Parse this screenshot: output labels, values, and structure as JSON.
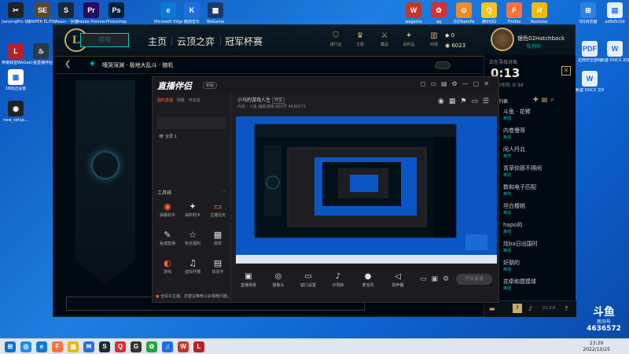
{
  "desktop": {
    "icons_top": [
      {
        "label": "JianyingPro 快捷方式",
        "color": "#222",
        "glyph": "✂"
      },
      {
        "label": "SNIPER ELITE V2",
        "color": "#5a4a2a",
        "glyph": "SE"
      },
      {
        "label": "steam - 快捷",
        "color": "#1b2838",
        "glyph": "S"
      },
      {
        "label": "Adobe Premiere",
        "color": "#2a0a5a",
        "glyph": "Pr"
      },
      {
        "label": "Photoshop",
        "color": "#001e36",
        "glyph": "Ps"
      },
      {
        "label": "Microsoft Edge",
        "color": "#0c7ad4",
        "glyph": "e"
      },
      {
        "label": "酷狗音乐",
        "color": "#1d6fe0",
        "glyph": "K"
      },
      {
        "label": "WeGame",
        "color": "#1a3a6a",
        "glyph": "▦"
      }
    ],
    "icons_top_right": [
      {
        "label": "wegame",
        "color": "#c0392b",
        "glyph": "W"
      },
      {
        "label": "qq",
        "color": "#d63030",
        "glyph": "✿"
      },
      {
        "label": "QQTeamPa",
        "color": "#f08a24",
        "glyph": "⊙"
      },
      {
        "label": "腾讯QQ",
        "color": "#f5c518",
        "glyph": "Q"
      },
      {
        "label": "Firefox",
        "color": "#ff7139",
        "glyph": "F"
      },
      {
        "label": "Rockstar",
        "color": "#f5b800",
        "glyph": "R"
      },
      {
        "label": "QQ浏览器",
        "color": "#2f7fe0",
        "glyph": "⊞"
      },
      {
        "label": "ad9d5c5d",
        "color": "#e8eef6",
        "glyph": "▤"
      }
    ],
    "icons_left": [
      {
        "label": "英雄联盟WeGame版",
        "color": "#b3222a",
        "glyph": "L"
      },
      {
        "label": "斗鱼直播伴侣",
        "color": "#2a3a4a",
        "glyph": "♨"
      },
      {
        "label": "18周边设置",
        "color": "#fff",
        "glyph": "▦"
      },
      {
        "label": "new_setup...",
        "color": "#222",
        "glyph": "◉"
      }
    ],
    "icons_right": [
      {
        "label": "拉西天空游戏",
        "color": "#e8eef6",
        "glyph": "PDF"
      },
      {
        "label": "新建 DOCX 文档",
        "color": "#e8eef6",
        "glyph": "W"
      },
      {
        "label": "新建 DOCX 文档(2)",
        "color": "#e8eef6",
        "glyph": "W"
      }
    ]
  },
  "lol": {
    "logo": "L",
    "play_button": "游戏",
    "nav": [
      "主页",
      "云顶之弈",
      "冠军杯赛"
    ],
    "tools": [
      {
        "icon": "shield-icon",
        "glyph": "⛉",
        "label": "通行证"
      },
      {
        "icon": "profile-icon",
        "glyph": "♛",
        "label": "主题"
      },
      {
        "icon": "collection-icon",
        "glyph": "⚔",
        "label": "藏品"
      },
      {
        "icon": "loot-icon",
        "glyph": "✦",
        "label": "战利品"
      },
      {
        "icon": "store-icon",
        "glyph": "▥",
        "label": "商城"
      }
    ],
    "currency_be": "0",
    "currency_rp": "6023",
    "summoner_name": "银色02Hatchback",
    "summoner_status": "队列中",
    "lobby_title": "嚎哭深渊 · 极地大乱斗 · 随机"
  },
  "social": {
    "queue_label": "正在寻找对局",
    "timer": "0:13",
    "queue_sub": "预估时间: 0:34",
    "section": "好友列表",
    "friends": [
      {
        "name": "斗鱼 · 花臂",
        "status": "离线"
      },
      {
        "name": "内卷慢哥",
        "status": "离线"
      },
      {
        "name": "闲人丹北",
        "status": "离开"
      },
      {
        "name": "青草你那不得闲",
        "status": "离线"
      },
      {
        "name": "数和电子匹配",
        "status": "离线"
      },
      {
        "name": "坦白樱桃",
        "status": "离线"
      },
      {
        "name": "hapo的",
        "status": "离线"
      },
      {
        "name": "炫ba日出国时",
        "status": "离线"
      },
      {
        "name": "好朋的",
        "status": "离线"
      },
      {
        "name": "花牵和摸摸球",
        "status": "离线"
      }
    ],
    "bottom_count": "7",
    "bottom_version": "V1.0.8"
  },
  "stream": {
    "logo": "直播伴侣",
    "version": "新版",
    "tabs": [
      "我的直播",
      "场景",
      "可多选"
    ],
    "scene": "全屏 1",
    "tool_title": "工具箱",
    "tools": [
      {
        "icon": "camera-icon",
        "glyph": "◉",
        "label": "弹幕助手",
        "accent": true
      },
      {
        "icon": "gift-icon",
        "glyph": "✦",
        "label": "抽奖助手",
        "accent": false
      },
      {
        "icon": "screen-icon",
        "glyph": "▭",
        "label": "主播任务",
        "accent": true
      },
      {
        "icon": "chat-icon",
        "glyph": "✎",
        "label": "鱼塘直播",
        "accent": false
      },
      {
        "icon": "star-icon",
        "glyph": "☆",
        "label": "粉丝福利",
        "accent": false
      },
      {
        "icon": "board-icon",
        "glyph": "▦",
        "label": "榜单",
        "accent": false
      },
      {
        "icon": "live-icon",
        "glyph": "◐",
        "label": "游戏",
        "accent": true
      },
      {
        "icon": "music-icon",
        "glyph": "♫",
        "label": "虚拟伴播",
        "accent": false
      },
      {
        "icon": "book-icon",
        "glyph": "▤",
        "label": "体验专",
        "accent": false
      }
    ],
    "note_prefix": "●",
    "note": "全民炎主播、您建议推荐公会相赠问题，请点击前去查看",
    "room_title": "小马的游戏人生",
    "room_badge": "开关",
    "room_meta": "内容  :  斗鱼    辅助通用    房间号  4636572",
    "bottom_tools": [
      {
        "icon": "scene-icon",
        "glyph": "▣",
        "label": "直播场景"
      },
      {
        "icon": "camera-icon",
        "glyph": "◎",
        "label": "摄像头"
      },
      {
        "icon": "screen-icon",
        "glyph": "▭",
        "label": "窗口设置"
      },
      {
        "icon": "mic-icon",
        "glyph": "♪",
        "label": "示例体"
      },
      {
        "icon": "audio-icon",
        "glyph": "●",
        "label": "麦克风"
      },
      {
        "icon": "speaker-icon",
        "glyph": "◁",
        "label": "扬声器"
      }
    ],
    "go_live": "开始直播"
  },
  "douyu": {
    "logo": "斗鱼",
    "room_label": "房间号",
    "room_number": "4636572"
  },
  "taskbar": {
    "time": "23:29",
    "date": "2022/10/25",
    "apps": [
      {
        "glyph": "⊞",
        "color": "#0a6fd6"
      },
      {
        "glyph": "◎",
        "color": "#1d8fe8"
      },
      {
        "glyph": "e",
        "color": "#0c7ad4"
      },
      {
        "glyph": "F",
        "color": "#ff7139"
      },
      {
        "glyph": "▦",
        "color": "#f0b400"
      },
      {
        "glyph": "✉",
        "color": "#2a6fd6"
      },
      {
        "glyph": "S",
        "color": "#1b2838"
      },
      {
        "glyph": "Q",
        "color": "#d63030"
      },
      {
        "glyph": "G",
        "color": "#333"
      },
      {
        "glyph": "✿",
        "color": "#27a345"
      },
      {
        "glyph": "♫",
        "color": "#1d6fe0"
      },
      {
        "glyph": "W",
        "color": "#c0392b"
      },
      {
        "glyph": "L",
        "color": "#b3222a"
      }
    ]
  }
}
